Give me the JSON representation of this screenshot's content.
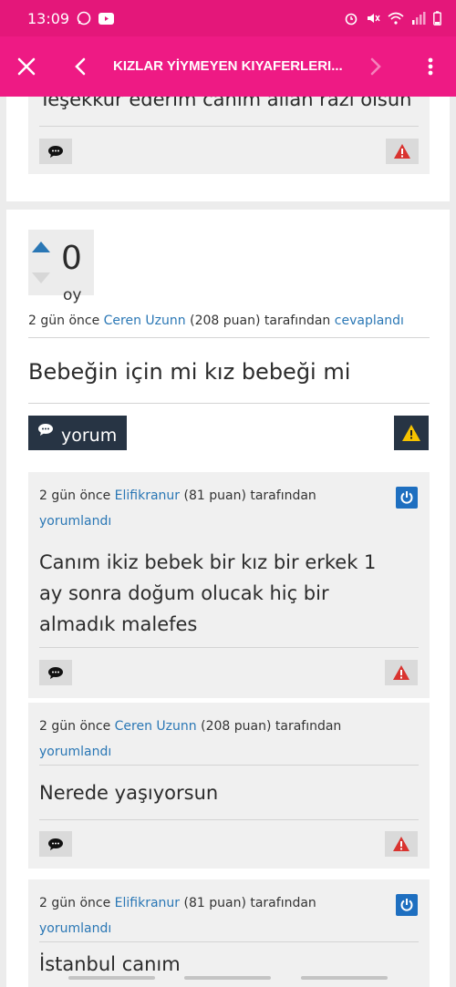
{
  "status": {
    "time": "13:09"
  },
  "toolbar": {
    "title": "KIZLAR YİYMEYEN KIYAFERLERI..."
  },
  "prev_comment": {
    "text": "Teşekkür ederim canım  allah razı olsun"
  },
  "answer": {
    "votes": "0",
    "votes_label": "oy",
    "time": "2 gün önce",
    "author": "Ceren Uzunn",
    "points": "(208 puan)",
    "by": "tarafından",
    "action": "cevaplandı",
    "text": "Bebeğin için mi kız bebeği mi",
    "comment_btn_label": "yorum"
  },
  "comments": [
    {
      "time": "2 gün önce",
      "author": "Elifikranur",
      "points": "(81 puan)",
      "by": "tarafından",
      "action": "yorumlandı",
      "text": "Canım ikiz bebek bir kız bir erkek 1 ay sonra doğum olucak hiç bir almadık malefes"
    },
    {
      "time": "2 gün önce",
      "author": "Ceren Uzunn",
      "points": "(208 puan)",
      "by": "tarafından",
      "action": "yorumlandı",
      "text": "Nerede yaşıyorsun"
    },
    {
      "time": "2 gün önce",
      "author": "Elifikranur",
      "points": "(81 puan)",
      "by": "tarafından",
      "action": "yorumlandı",
      "text": "İstanbul canım"
    }
  ],
  "icons": {
    "close": "close-icon",
    "back": "chevron-left-icon",
    "forward": "chevron-right-icon",
    "more": "more-vert-icon",
    "comment": "speech-bubble-icon",
    "flag": "warning-icon",
    "power": "power-icon",
    "vote_up": "arrow-up-icon",
    "vote_down": "arrow-down-icon"
  },
  "colors": {
    "statusbar": "#e4177a",
    "toolbar": "#ee1a84",
    "link": "#2a77b5",
    "dark_button": "#273444",
    "vote_arrow": "#2a77b5"
  }
}
